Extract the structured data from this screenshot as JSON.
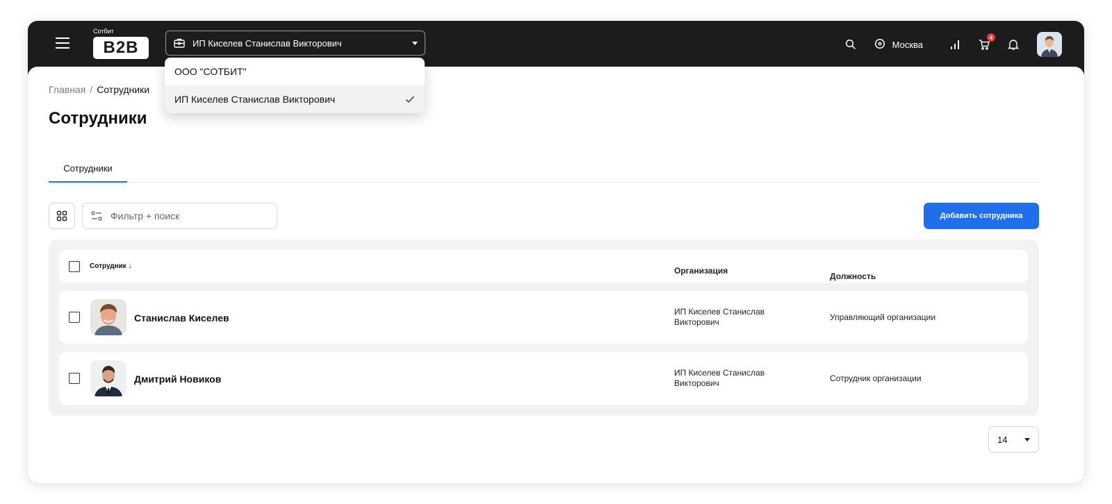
{
  "header": {
    "logo_small": "Сотбит",
    "logo_text": "B2B",
    "org_selected": "ИП Киселев Станислав Викторович",
    "city": "Москва",
    "cart_badge": "4",
    "icons": [
      "menu-icon",
      "briefcase-icon",
      "search-icon",
      "location-icon",
      "chart-icon",
      "cart-icon",
      "bell-icon"
    ]
  },
  "org_dropdown": {
    "options": [
      {
        "label": "ООО \"СОТБИТ\"",
        "selected": false
      },
      {
        "label": "ИП Киселев Станислав Викторович",
        "selected": true
      }
    ]
  },
  "breadcrumb": {
    "home": "Главная",
    "separator": "/",
    "current": "Сотрудники"
  },
  "page": {
    "title": "Сотрудники",
    "tab": "Сотрудники"
  },
  "toolbar": {
    "search_placeholder": "Фильтр + поиск",
    "add_button": "Добавить сотрудника"
  },
  "table": {
    "headers": {
      "employee": "Сотрудник",
      "sort_arrow": "↓",
      "organization": "Организация",
      "position": "Должность"
    },
    "rows": [
      {
        "name": "Станислав Киселев",
        "organization": "ИП Киселев Станислав Викторович",
        "position": "Управляющий организации"
      },
      {
        "name": "Дмитрий Новиков",
        "organization": "ИП Киселев Станислав Викторович",
        "position": "Сотрудник организации"
      }
    ]
  },
  "pagination": {
    "per_page": "14"
  },
  "colors": {
    "header_bg": "#1c1c1c",
    "accent": "#1f6feb",
    "badge": "#e53935"
  }
}
